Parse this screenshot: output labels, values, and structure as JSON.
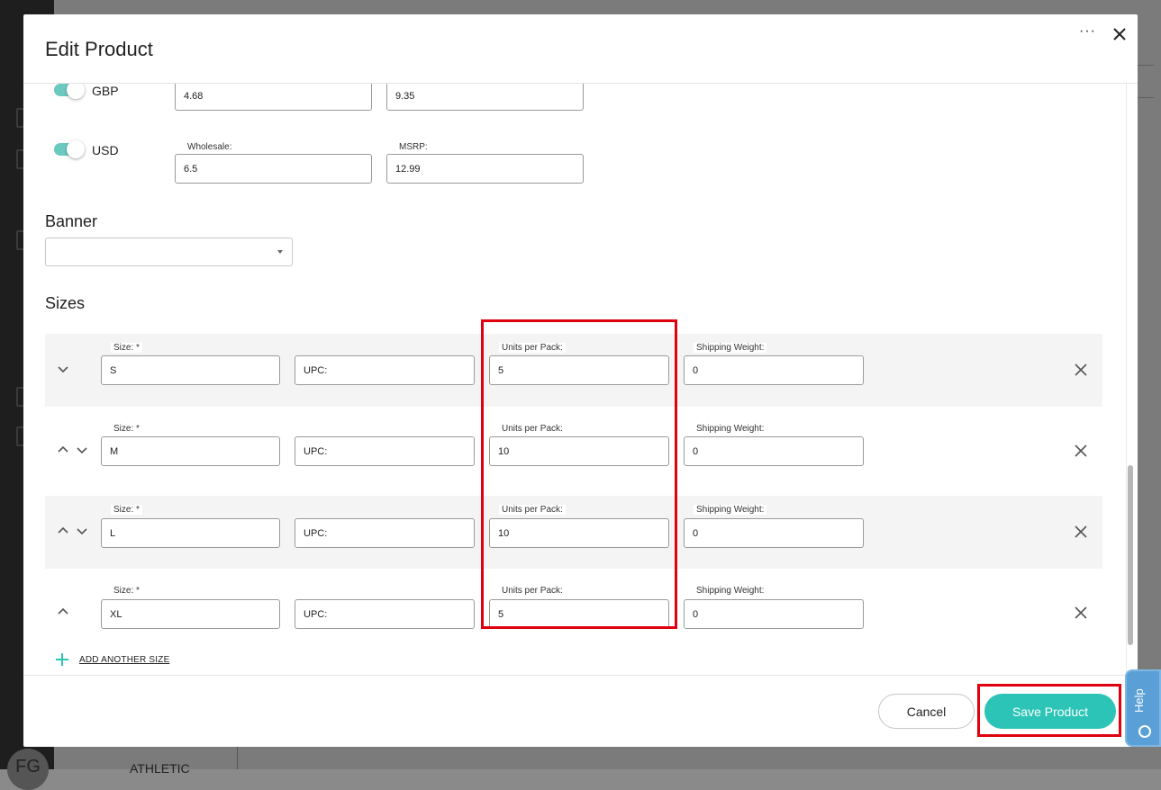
{
  "background": {
    "avatar_initials": "FG",
    "category_text": "ATHLETIC"
  },
  "modal": {
    "title": "Edit Product",
    "more_label": "···",
    "currencies": [
      {
        "code": "GBP",
        "enabled": true,
        "wholesale": "4.68",
        "msrp": "9.35"
      },
      {
        "code": "USD",
        "enabled": true,
        "wholesale_label": "Wholesale:",
        "msrp_label": "MSRP:",
        "wholesale": "6.5",
        "msrp": "12.99"
      }
    ],
    "banner": {
      "title": "Banner",
      "value": ""
    },
    "sizes": {
      "title": "Sizes",
      "size_label": "Size: *",
      "upc_placeholder": "UPC:",
      "units_label": "Units per Pack:",
      "weight_label": "Shipping Weight:",
      "rows": [
        {
          "size": "S",
          "units": "5",
          "weight": "0"
        },
        {
          "size": "M",
          "units": "10",
          "weight": "0"
        },
        {
          "size": "L",
          "units": "10",
          "weight": "0"
        },
        {
          "size": "XL",
          "units": "5",
          "weight": "0"
        }
      ],
      "add_label": "ADD ANOTHER SIZE"
    },
    "footer": {
      "cancel_label": "Cancel",
      "save_label": "Save Product"
    }
  },
  "help": {
    "label": "Help"
  },
  "colors": {
    "accent": "#2cc4b6",
    "toggle": "#6cc9c0",
    "highlight": "#e0000f",
    "help": "#5aa0d6"
  }
}
